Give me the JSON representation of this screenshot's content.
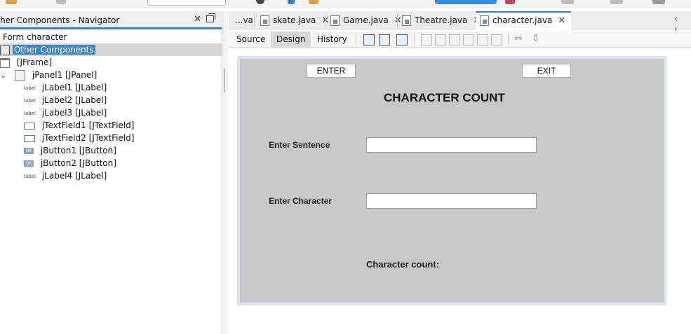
{
  "navigator": {
    "title": "her Components - Navigator",
    "close": "✕",
    "tree": [
      {
        "label": "Form character"
      },
      {
        "label": "Other Components",
        "selected": true
      },
      {
        "label": "[JFrame]"
      },
      {
        "label": "jPanel1 [JPanel]"
      },
      {
        "label": "jLabel1 [JLabel]",
        "icon": "label"
      },
      {
        "label": "jLabel2 [JLabel]",
        "icon": "label"
      },
      {
        "label": "jLabel3 [JLabel]",
        "icon": "label"
      },
      {
        "label": "jTextField1 [JTextField]"
      },
      {
        "label": "jTextField2 [JTextField]"
      },
      {
        "label": "jButton1 [JButton]",
        "icon": "OK"
      },
      {
        "label": "jButton2 [JButton]",
        "icon": "OK"
      },
      {
        "label": "jLabel4 [JLabel]",
        "icon": "label"
      }
    ]
  },
  "tabs": [
    {
      "label": "...va"
    },
    {
      "label": "skate.java",
      "close": "✕"
    },
    {
      "label": "Game.java",
      "close": "✕"
    },
    {
      "label": "Theatre.java",
      "close": "✕"
    },
    {
      "label": "character.java",
      "close": "✕",
      "active": true
    }
  ],
  "tab_scroll": "‹ ›",
  "design_toolbar": {
    "source": "Source",
    "design": "Design",
    "history": "History"
  },
  "form": {
    "enter_button": "ENTER",
    "exit_button": "EXIT",
    "heading": "CHARACTER COUNT",
    "sentence_label": "Enter  Sentence",
    "sentence_value": "",
    "character_label": "Enter Character",
    "character_value": "",
    "count_label": "Character count:"
  },
  "colors": {
    "accent": "#3c7fc3",
    "selection": "#3d86c6",
    "form_bg": "#c8c8c8"
  }
}
